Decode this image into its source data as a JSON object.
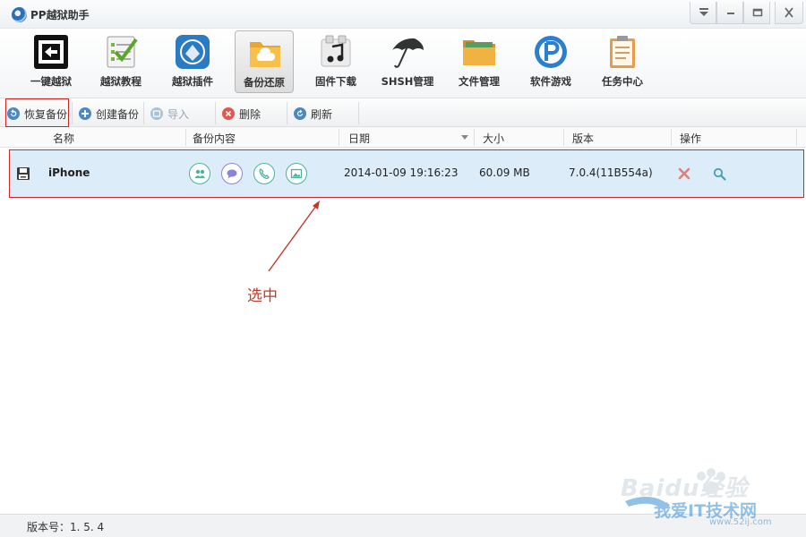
{
  "window": {
    "title": "PP越狱助手"
  },
  "toolbar": {
    "items": [
      {
        "label": "一键越狱",
        "icon": "jailbreak-icon"
      },
      {
        "label": "越狱教程",
        "icon": "checklist-icon"
      },
      {
        "label": "越狱插件",
        "icon": "cydia-icon"
      },
      {
        "label": "备份还原",
        "icon": "backup-folder-icon",
        "active": true
      },
      {
        "label": "固件下载",
        "icon": "firmware-icon"
      },
      {
        "label": "SHSH管理",
        "icon": "umbrella-icon"
      },
      {
        "label": "文件管理",
        "icon": "folder-icon"
      },
      {
        "label": "软件游戏",
        "icon": "pp-icon"
      },
      {
        "label": "任务中心",
        "icon": "clipboard-icon"
      }
    ]
  },
  "actions": {
    "restore": "恢复备份",
    "create": "创建备份",
    "import": "导入",
    "delete": "删除",
    "refresh": "刷新"
  },
  "table": {
    "columns": [
      "名称",
      "备份内容",
      "日期",
      "大小",
      "版本",
      "操作"
    ],
    "rows": [
      {
        "name": "iPhone",
        "date": "2014-01-09 19:16:23",
        "size": "60.09 MB",
        "version": "7.0.4(11B554a)"
      }
    ]
  },
  "annotation": {
    "text": "选中"
  },
  "status": {
    "version": "版本号：1. 5. 4"
  },
  "watermark": {
    "line1": "Baidu经验",
    "line2": "我爱IT技术网",
    "line3": "www.52ij.com"
  },
  "colors": {
    "highlight_border": "#c92a2a",
    "row_selected": "#dcecf8",
    "accent_blue": "#3a8fd6",
    "content_icon_green": "#4db39a"
  }
}
